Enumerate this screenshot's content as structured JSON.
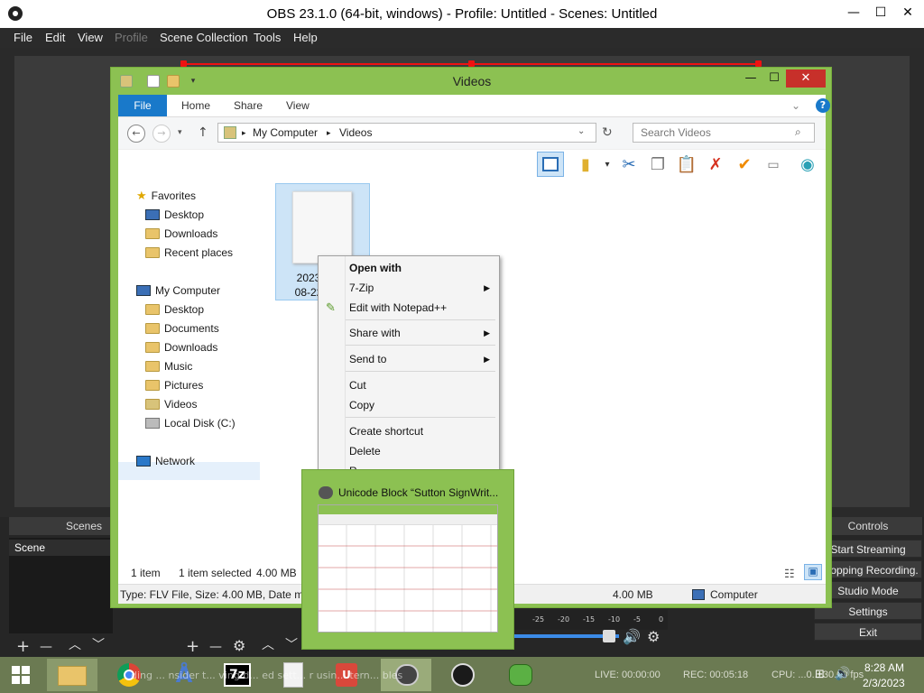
{
  "obs": {
    "title": "OBS 23.1.0 (64-bit, windows) - Profile: Untitled - Scenes: Untitled",
    "menu": [
      "File",
      "Edit",
      "View",
      "Profile",
      "Scene Collection",
      "Tools",
      "Help"
    ],
    "window_controls": {
      "minimize": "—",
      "maximize": "☐",
      "close": "✕"
    },
    "docks": {
      "scenes": "Scenes",
      "controls": "Controls"
    },
    "scene_item": "Scene",
    "controls": [
      "Start Streaming",
      "topping Recording.",
      "Studio Mode",
      "Settings",
      "Exit"
    ],
    "mixer_scale": [
      "-25",
      "-20",
      "-15",
      "-10",
      "-5",
      "0"
    ],
    "tools": {
      "add": "+",
      "remove": "—",
      "up": "︿",
      "down": "﹀",
      "gear": "⚙"
    },
    "overlap_text": "ding ... nsider t... ving d... ed sett... r usin... tern... bles"
  },
  "explorer": {
    "title": "Videos",
    "ribbon_tabs": {
      "file": "File",
      "home": "Home",
      "share": "Share",
      "view": "View"
    },
    "address": {
      "root": "My Computer",
      "current": "Videos"
    },
    "search_placeholder": "Search Videos",
    "nav_pane": {
      "favorites_header": "Favorites",
      "favorites": [
        "Desktop",
        "Downloads",
        "Recent places"
      ],
      "computer_header": "My Computer",
      "computer": [
        "Desktop",
        "Documents",
        "Downloads",
        "Music",
        "Pictures",
        "Videos",
        "Local Disk (C:)"
      ],
      "network": "Network"
    },
    "file": {
      "label_line1": "2023",
      "label_line2": "08-22"
    },
    "status": {
      "count": "1 item",
      "selected": "1 item selected",
      "size": "4.00 MB"
    },
    "details": {
      "info": "Type: FLV File, Size: 4.00 MB, Date mod",
      "size": "4.00 MB",
      "location": "Computer"
    }
  },
  "context_menu": {
    "open_with": "Open with",
    "zip": "7-Zip",
    "notepad": "Edit with Notepad++",
    "share_with": "Share with",
    "send_to": "Send to",
    "cut": "Cut",
    "copy": "Copy",
    "create_shortcut": "Create shortcut",
    "delete": "Delete",
    "rename": "R"
  },
  "thumbnail": {
    "title": "Unicode Block “Sutton SignWrit..."
  },
  "taskbar": {
    "live": "LIVE: 00:00:00",
    "rec": "REC: 00:05:18",
    "cpu": "CPU: ...0... 30.00 fps",
    "time": "8:28 AM",
    "date": "2/3/2023",
    "zip_label": "7z"
  },
  "colors": {
    "explorer_frame": "#8cc152",
    "ribbon_blue": "#1979ca",
    "close_red": "#c7302a",
    "recording_red": "#e11111",
    "taskbar": "#6b7a52"
  }
}
